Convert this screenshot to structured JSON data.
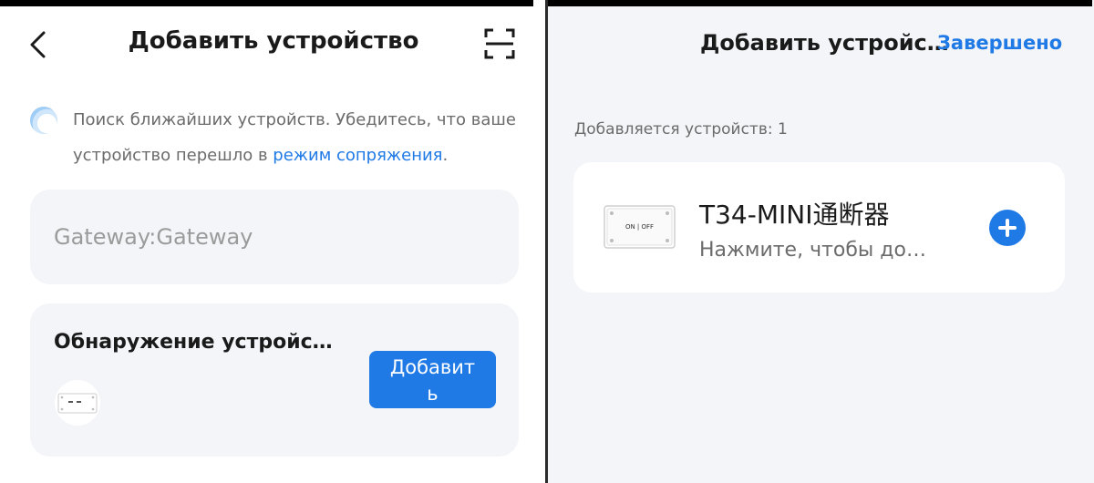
{
  "left": {
    "title": "Добавить устройство",
    "back_icon": "chevron-left-icon",
    "scan_icon": "scan-frame-icon",
    "search": {
      "text": "Поиск ближайших устройств. Убедитесь, что ваше устройство перешло в ",
      "link": "режим сопряжения",
      "suffix": "."
    },
    "gateway_label": "Gateway:Gateway",
    "detect": {
      "title": "Обнаружение устройс…",
      "add_button_line1": "Добавит",
      "add_button_line2": "ь"
    }
  },
  "right": {
    "title": "Добавить устройс…",
    "done_label": "Завершено",
    "adding_count": "Добавляется устройств: 1",
    "device": {
      "name": "T34-MINI通断器",
      "subtitle": "Нажмите, чтобы до…",
      "thumb_label": "ON | OFF"
    }
  },
  "colors": {
    "accent": "#1f7ae6",
    "card_bg": "#f4f5f9",
    "text_dark": "#1a1a1a",
    "text_muted": "#6b6b6b"
  }
}
